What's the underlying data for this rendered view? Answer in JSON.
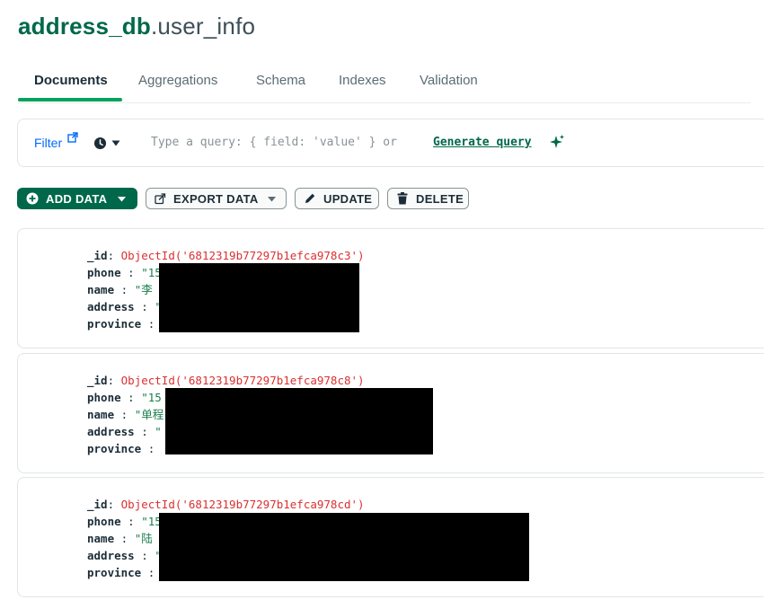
{
  "header": {
    "db_name": "address_db",
    "separator": ".",
    "collection_name": "user_info"
  },
  "tabs": [
    {
      "label": "Documents",
      "active": true
    },
    {
      "label": "Aggregations",
      "active": false
    },
    {
      "label": "Schema",
      "active": false
    },
    {
      "label": "Indexes",
      "active": false
    },
    {
      "label": "Validation",
      "active": false
    }
  ],
  "filter": {
    "label": "Filter",
    "placeholder": "Type a query: { field: 'value' } or",
    "generate_label": "Generate query"
  },
  "toolbar": {
    "add_data": "ADD DATA",
    "export_data": "EXPORT DATA",
    "update": "UPDATE",
    "delete": "DELETE"
  },
  "documents": [
    {
      "id_key": "_id",
      "id_value": "ObjectId('6812319b77297b1efca978c3')",
      "phone_key": "phone",
      "phone_value": "\"15",
      "name_key": "name",
      "name_value": "\"李",
      "address_key": "address",
      "address_value": "\"",
      "address_tail": "\"",
      "province_key": "province",
      "province_value": ""
    },
    {
      "id_key": "_id",
      "id_value": "ObjectId('6812319b77297b1efca978c8')",
      "phone_key": "phone",
      "phone_value": "\"15",
      "name_key": "name",
      "name_value": "\"单程",
      "address_key": "address",
      "address_value": "\"",
      "address_tail": "\"",
      "province_key": "province",
      "province_value": ""
    },
    {
      "id_key": "_id",
      "id_value": "ObjectId('6812319b77297b1efca978cd')",
      "phone_key": "phone",
      "phone_value": "\"15",
      "name_key": "name",
      "name_value": "\"陆",
      "address_key": "address",
      "address_value": "\"",
      "address_tail": "",
      "province_key": "province",
      "province_value": ""
    }
  ],
  "colors": {
    "brand_green": "#00684a",
    "active_tab_underline": "#00a35c",
    "object_id": "#db3030",
    "filter_link": "#016bf8"
  }
}
